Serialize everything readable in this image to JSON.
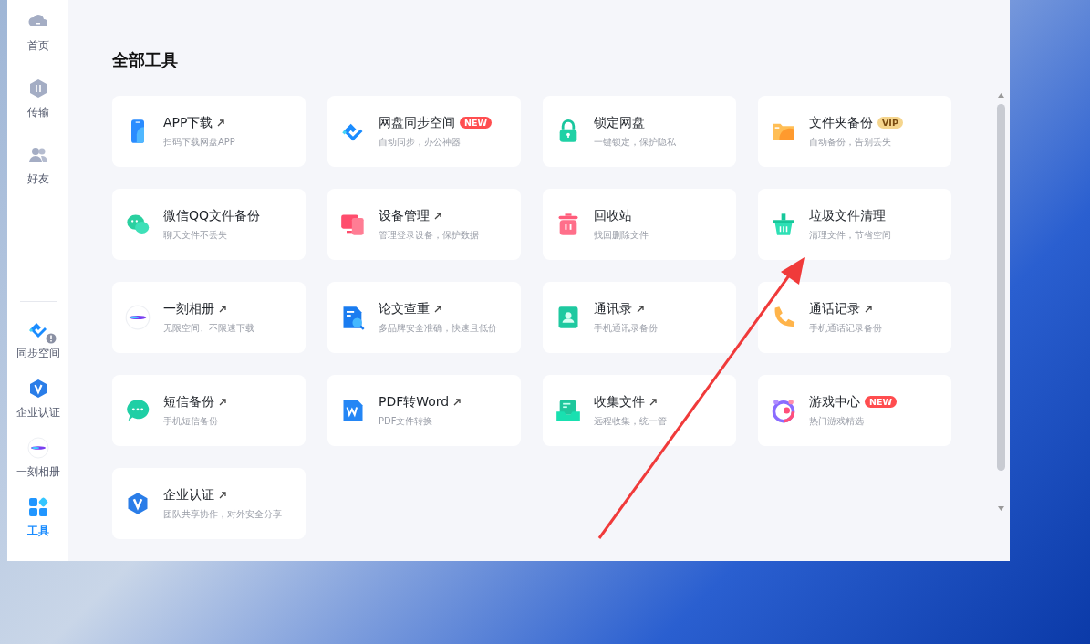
{
  "sidebar": {
    "items": [
      {
        "label": "首页",
        "selected": false
      },
      {
        "label": "传输",
        "selected": false
      },
      {
        "label": "好友",
        "selected": false
      }
    ],
    "apps": [
      {
        "label": "同步空间",
        "selected": false
      },
      {
        "label": "企业认证",
        "selected": false
      },
      {
        "label": "一刻相册",
        "selected": false
      },
      {
        "label": "工具",
        "selected": true
      }
    ]
  },
  "main": {
    "title": "全部工具",
    "tools": [
      {
        "title": "APP下载",
        "subtitle": "扫码下载网盘APP",
        "external": true
      },
      {
        "title": "网盘同步空间",
        "subtitle": "自动同步，办公神器",
        "external": false,
        "badge": {
          "text": "NEW",
          "kind": "new"
        }
      },
      {
        "title": "锁定网盘",
        "subtitle": "一键锁定，保护隐私",
        "external": false
      },
      {
        "title": "文件夹备份",
        "subtitle": "自动备份，告别丢失",
        "external": false,
        "badge": {
          "text": "VIP",
          "kind": "vip"
        }
      },
      {
        "title": "微信QQ文件备份",
        "subtitle": "聊天文件不丢失",
        "external": false
      },
      {
        "title": "设备管理",
        "subtitle": "管理登录设备，保护数据",
        "external": true
      },
      {
        "title": "回收站",
        "subtitle": "找回删除文件",
        "external": false
      },
      {
        "title": "垃圾文件清理",
        "subtitle": "清理文件，节省空间",
        "external": false
      },
      {
        "title": "一刻相册",
        "subtitle": "无限空间、不限速下载",
        "external": true
      },
      {
        "title": "论文查重",
        "subtitle": "多品牌安全准确，快速且低价",
        "external": true
      },
      {
        "title": "通讯录",
        "subtitle": "手机通讯录备份",
        "external": true
      },
      {
        "title": "通话记录",
        "subtitle": "手机通话记录备份",
        "external": true
      },
      {
        "title": "短信备份",
        "subtitle": "手机短信备份",
        "external": true
      },
      {
        "title": "PDF转Word",
        "subtitle": "PDF文件转换",
        "external": true
      },
      {
        "title": "收集文件",
        "subtitle": "远程收集，统一管",
        "external": true
      },
      {
        "title": "游戏中心",
        "subtitle": "热门游戏精选",
        "external": false,
        "badge": {
          "text": "NEW",
          "kind": "new"
        }
      },
      {
        "title": "企业认证",
        "subtitle": "团队共享协作，对外安全分享",
        "external": true
      }
    ]
  }
}
